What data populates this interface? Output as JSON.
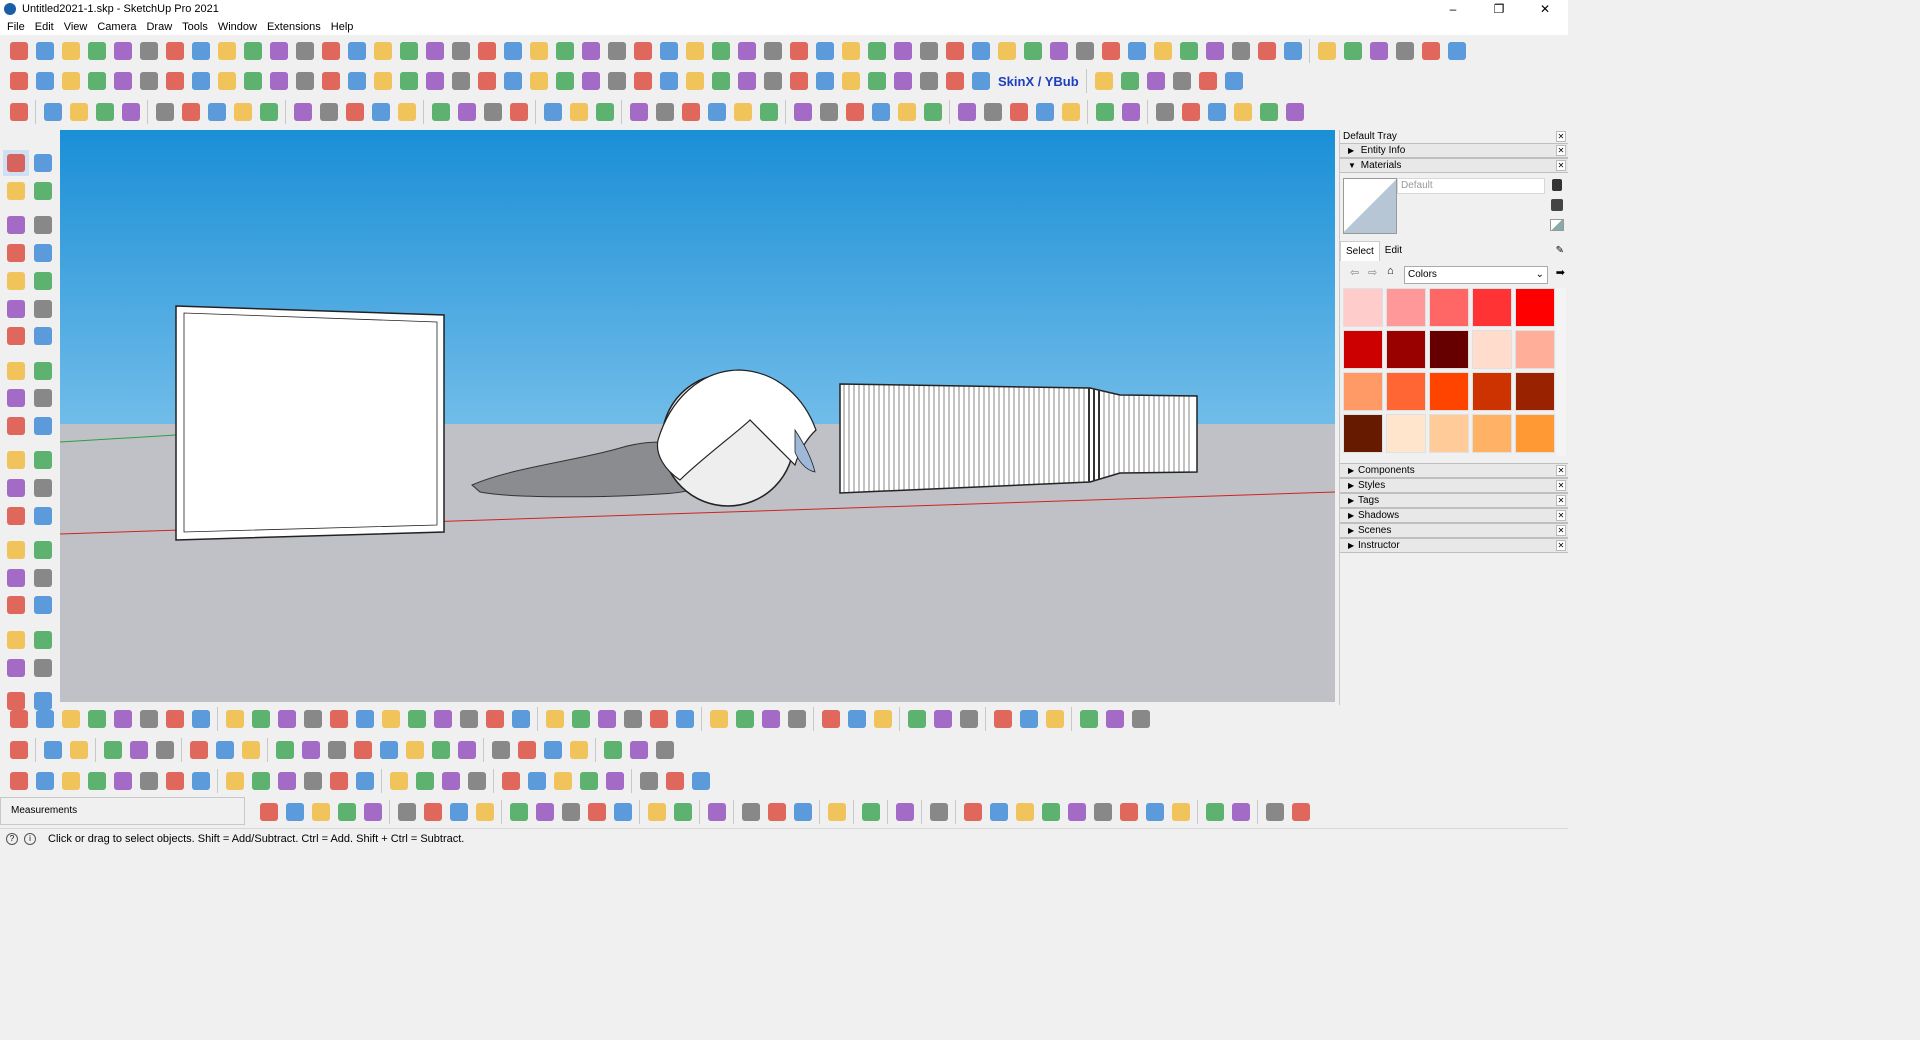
{
  "window": {
    "title": "Untitled2021-1.skp - SketchUp Pro 2021",
    "minimize": "–",
    "maximize": "❐",
    "close": "✕"
  },
  "menu": [
    "File",
    "Edit",
    "View",
    "Camera",
    "Draw",
    "Tools",
    "Window",
    "Extensions",
    "Help"
  ],
  "toolbar": {
    "skinx_label": "SkinX / YBub"
  },
  "tray": {
    "title": "Default Tray",
    "panels_top": [
      {
        "label": "Entity Info",
        "expanded": false
      },
      {
        "label": "Materials",
        "expanded": true
      }
    ],
    "materials": {
      "current_name": "Default",
      "tabs": [
        "Select",
        "Edit"
      ],
      "active_tab": "Select",
      "library": "Colors",
      "swatches": [
        "#ffcccc",
        "#ff9999",
        "#ff6666",
        "#ff3333",
        "#ff0000",
        "#cc0000",
        "#990000",
        "#660000",
        "#ffdccc",
        "#ffae99",
        "#ff9966",
        "#ff6633",
        "#ff4400",
        "#cc3300",
        "#992200",
        "#661a00",
        "#ffe5cc",
        "#ffcc99",
        "#ffb266",
        "#ff9933"
      ]
    },
    "panels_bottom": [
      "Components",
      "Styles",
      "Tags",
      "Shadows",
      "Scenes",
      "Instructor"
    ]
  },
  "measurements_label": "Measurements",
  "status_text": "Click or drag to select objects. Shift = Add/Subtract. Ctrl = Add. Shift + Ctrl = Subtract.",
  "icons": {
    "accent_colors": [
      "#d93a2b",
      "#2a7fd4",
      "#f0b429",
      "#2e9e44",
      "#8a3fb8",
      "#666666"
    ]
  }
}
